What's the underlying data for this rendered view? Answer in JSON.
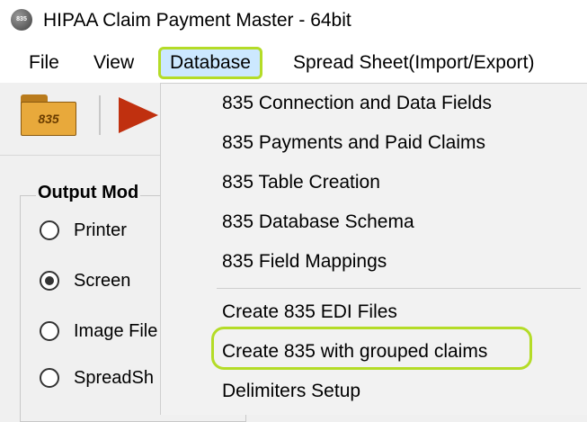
{
  "window": {
    "title": "HIPAA Claim Payment Master - 64bit",
    "icon": "app-icon",
    "icon_text": "835"
  },
  "menubar": {
    "items": [
      {
        "label": "File"
      },
      {
        "label": "View"
      },
      {
        "label": "Database"
      },
      {
        "label": "Spread Sheet(Import/Export)"
      }
    ],
    "active": "Database"
  },
  "toolbar": {
    "open_835_label": "835",
    "open_icon": "folder-835-icon",
    "run_icon": "play-icon"
  },
  "output_mode": {
    "title": "Output Mod",
    "options": [
      {
        "label": "Printer",
        "checked": false
      },
      {
        "label": "Screen",
        "checked": true
      },
      {
        "label": "Image File",
        "checked": false
      },
      {
        "label": "SpreadSh",
        "checked": false
      }
    ]
  },
  "database_menu": {
    "items": [
      {
        "label": "835 Connection and Data Fields"
      },
      {
        "label": "835 Payments and Paid Claims"
      },
      {
        "label": "835 Table Creation"
      },
      {
        "label": "835 Database Schema"
      },
      {
        "label": "835 Field Mappings"
      },
      {
        "label": "Create 835 EDI Files"
      },
      {
        "label": "Create 835 with grouped claims"
      },
      {
        "label": "Delimiters Setup"
      }
    ],
    "highlight_color": "#b4dc27"
  }
}
